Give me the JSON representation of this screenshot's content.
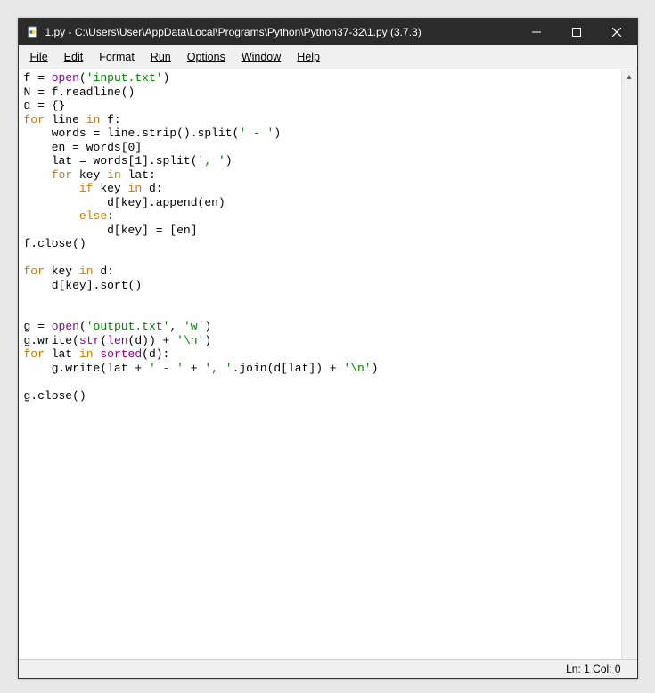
{
  "titlebar": {
    "title": "1.py - C:\\Users\\User\\AppData\\Local\\Programs\\Python\\Python37-32\\1.py (3.7.3)"
  },
  "menu": {
    "file": "File",
    "edit": "Edit",
    "format": "Format",
    "run": "Run",
    "options": "Options",
    "window": "Window",
    "help": "Help"
  },
  "code": {
    "l1a": "f = ",
    "l1b": "open",
    "l1c": "(",
    "l1d": "'input.txt'",
    "l1e": ")",
    "l2": "N = f.readline()",
    "l3": "d = {}",
    "l4a": "for",
    "l4b": " line ",
    "l4c": "in",
    "l4d": " f:",
    "l5a": "    words = line.strip().split(",
    "l5b": "' - '",
    "l5c": ")",
    "l6": "    en = words[0]",
    "l7a": "    lat = words[1].split(",
    "l7b": "', '",
    "l7c": ")",
    "l8a": "    ",
    "l8b": "for",
    "l8c": " key ",
    "l8d": "in",
    "l8e": " lat:",
    "l9a": "        ",
    "l9b": "if",
    "l9c": " key ",
    "l9d": "in",
    "l9e": " d:",
    "l10": "            d[key].append(en)",
    "l11a": "        ",
    "l11b": "else",
    "l11c": ":",
    "l12": "            d[key] = [en]",
    "l13": "f.close()",
    "l14": "",
    "l15a": "for",
    "l15b": " key ",
    "l15c": "in",
    "l15d": " d:",
    "l16": "    d[key].sort()",
    "l17": "",
    "l18": "",
    "l19a": "g = ",
    "l19b": "open",
    "l19c": "(",
    "l19d": "'output.txt'",
    "l19e": ", ",
    "l19f": "'w'",
    "l19g": ")",
    "l20a": "g.write(",
    "l20b": "str",
    "l20c": "(",
    "l20d": "len",
    "l20e": "(d)) + ",
    "l20f": "'\\n'",
    "l20g": ")",
    "l21a": "for",
    "l21b": " lat ",
    "l21c": "in",
    "l21d": " ",
    "l21e": "sorted",
    "l21f": "(d):",
    "l22a": "    g.write(lat + ",
    "l22b": "' - '",
    "l22c": " + ",
    "l22d": "', '",
    "l22e": ".join(d[lat]) + ",
    "l22f": "'\\n'",
    "l22g": ")",
    "l23": "",
    "l24": "g.close()"
  },
  "status": {
    "position": "Ln: 1  Col: 0"
  }
}
